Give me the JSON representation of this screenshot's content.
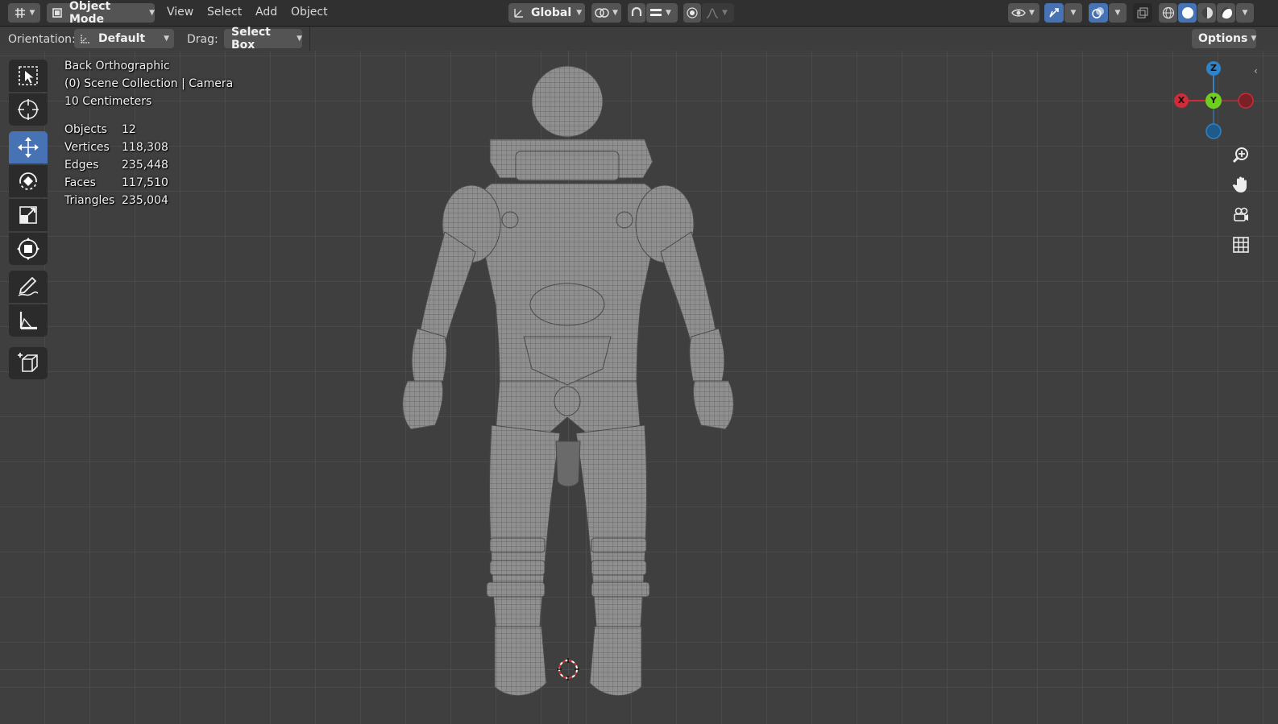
{
  "header": {
    "mode_label": "Object Mode",
    "menus": [
      "View",
      "Select",
      "Add",
      "Object"
    ],
    "orientation_global": "Global",
    "icons": [
      "editor-type-icon",
      "object-mode-icon",
      "transform-orientation-icon",
      "pivot-icon",
      "snap-icon",
      "snap-increment-icon",
      "proportional-edit-icon",
      "falloff-icon",
      "visibility-icon",
      "gizmo-icon",
      "overlay-icon",
      "xray-icon",
      "wireframe-shading-icon",
      "solid-shading-icon",
      "material-preview-icon",
      "rendered-shading-icon"
    ]
  },
  "toolbar": {
    "orientation_label": "Orientation:",
    "orientation_value": "Default",
    "drag_label": "Drag:",
    "drag_value": "Select Box",
    "options_label": "Options"
  },
  "tools": [
    "select-box-tool",
    "cursor-tool",
    "move-tool",
    "rotate-tool",
    "scale-tool",
    "transform-tool",
    "annotate-tool",
    "measure-tool",
    "add-cube-tool"
  ],
  "active_tool": "move-tool",
  "viewport": {
    "view_name": "Back Orthographic",
    "collection": "(0) Scene Collection | Camera",
    "grid_scale": "10 Centimeters",
    "stats": [
      {
        "label": "Objects",
        "value": "12"
      },
      {
        "label": "Vertices",
        "value": "118,308"
      },
      {
        "label": "Edges",
        "value": "235,448"
      },
      {
        "label": "Faces",
        "value": "117,510"
      },
      {
        "label": "Triangles",
        "value": "235,004"
      }
    ]
  },
  "gizmo": {
    "z": "Z",
    "y": "Y",
    "x": "X",
    "z_color": "#2f83c9",
    "y_color": "#6fcf1f",
    "x_color": "#d02b36"
  },
  "nav_buttons": [
    "zoom-icon",
    "hand-pan-icon",
    "camera-view-icon",
    "grid-ortho-icon"
  ],
  "colors": {
    "accent": "#4772b3",
    "x_axis": "#9c2a2a",
    "y_axis": "#2a5a9c"
  }
}
